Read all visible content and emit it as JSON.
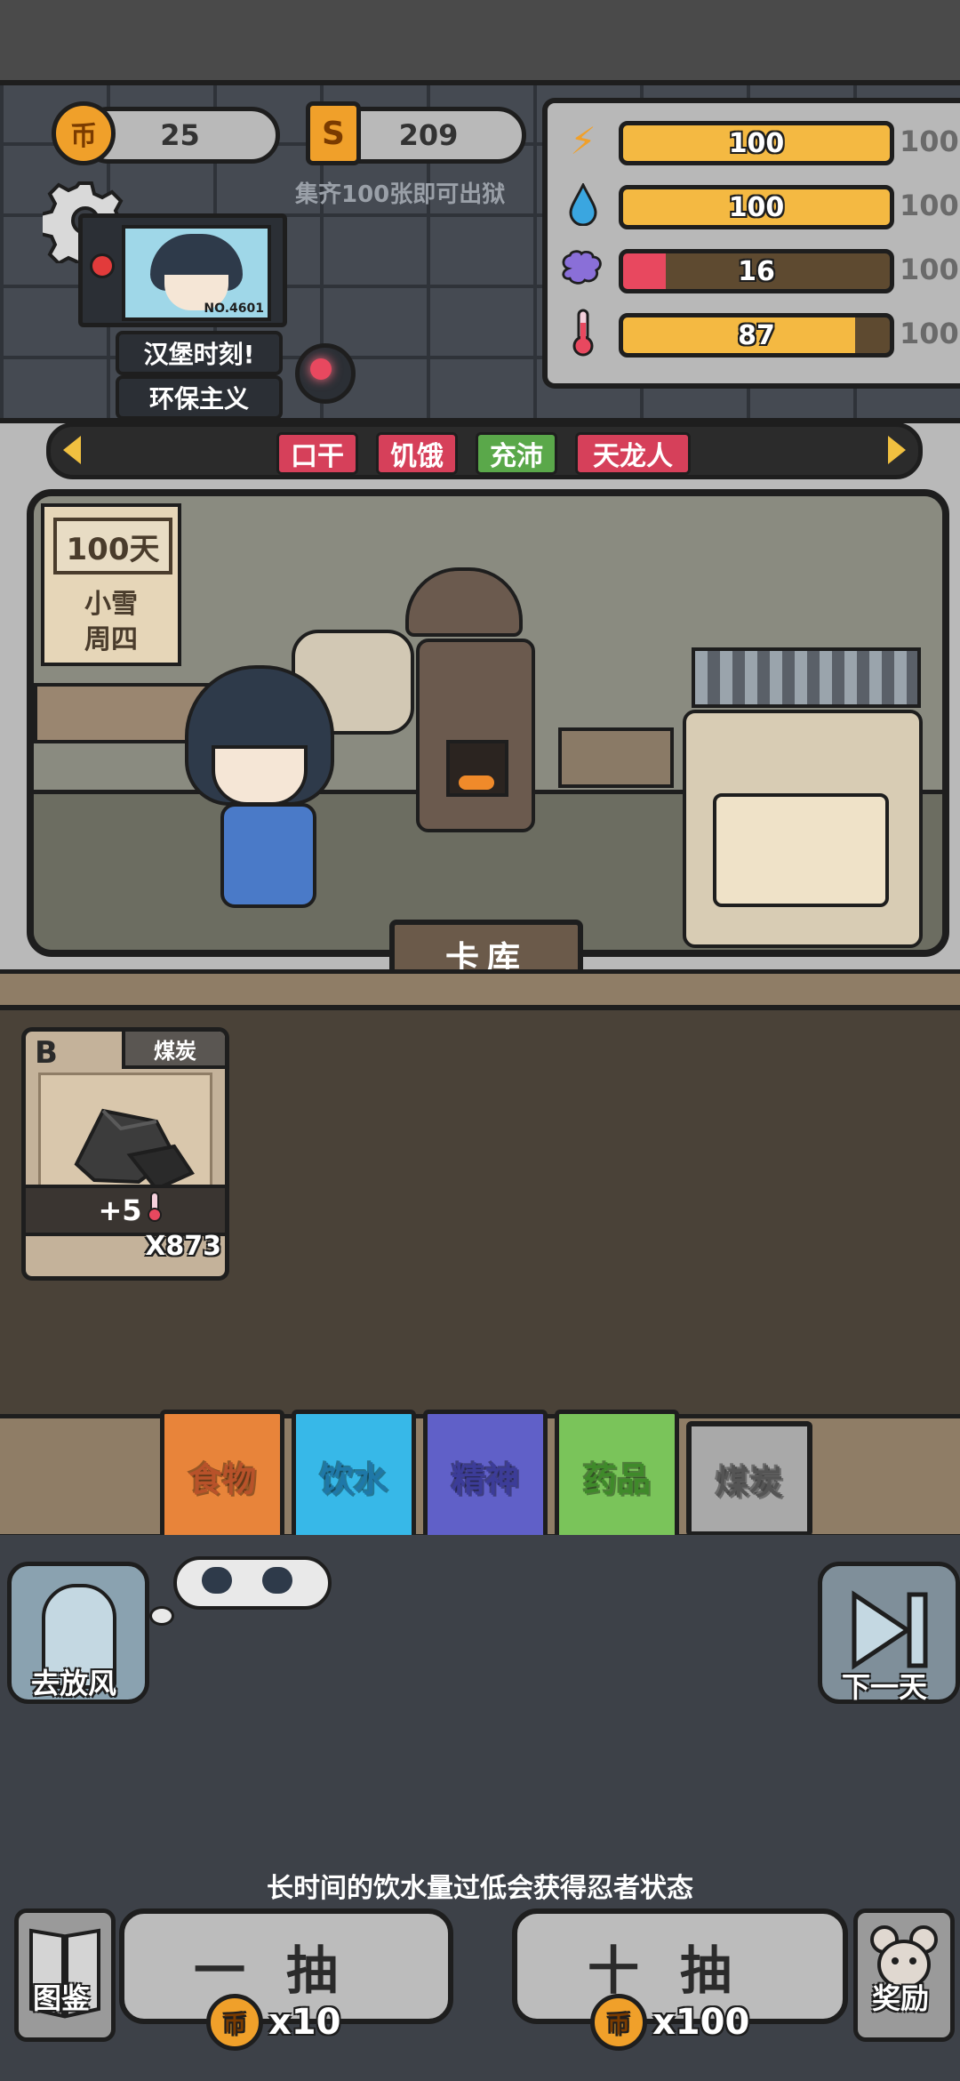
{
  "currency": {
    "coin_icon": "币",
    "coins": "25",
    "ticket_icon": "S",
    "tickets": "209",
    "hint": "集齐100张即可出狱"
  },
  "stats": [
    {
      "name": "energy",
      "icon": "lightning-icon",
      "value": "100",
      "max": "100",
      "fraction": 1.0,
      "color": "#f4b942"
    },
    {
      "name": "water",
      "icon": "water-drop-icon",
      "value": "100",
      "max": "100",
      "fraction": 1.0,
      "color": "#f4b942"
    },
    {
      "name": "mind",
      "icon": "brain-icon",
      "value": "16",
      "max": "100",
      "fraction": 0.16,
      "color": "#e8485f"
    },
    {
      "name": "warmth",
      "icon": "thermometer-icon",
      "value": "87",
      "max": "100",
      "fraction": 0.87,
      "color": "#f4b942"
    }
  ],
  "monitor": {
    "id": "NO.4601"
  },
  "tags": {
    "first": "汉堡时刻!",
    "second": "环保主义"
  },
  "status_chips": [
    {
      "label": "口干",
      "color": "#d6405a"
    },
    {
      "label": "饥饿",
      "color": "#d6405a"
    },
    {
      "label": "充沛",
      "color": "#5aa84a"
    },
    {
      "label": "天龙人",
      "color": "#d6405a"
    }
  ],
  "calendar": {
    "days": "100天",
    "weather": "小雪",
    "weekday": "周四"
  },
  "vault_label": "卡库",
  "cards": [
    {
      "grade": "B",
      "name": "煤炭",
      "effect": "+5",
      "count": "X873"
    }
  ],
  "categories": [
    {
      "label": "食物",
      "bg": "#e8843a",
      "fg": "#b8522a"
    },
    {
      "label": "饮水",
      "bg": "#37b8e8",
      "fg": "#1f78a8"
    },
    {
      "label": "精神",
      "bg": "#6060c8",
      "fg": "#3c3c98"
    },
    {
      "label": "药品",
      "bg": "#7ac45a",
      "fg": "#3f8a2a"
    },
    {
      "label": "煤炭",
      "bg": "#a9a9a9",
      "fg": "#555555"
    }
  ],
  "buttons": {
    "go_out": "去放风",
    "next_day": "下一天",
    "gallery": "图鉴",
    "reward": "奖励",
    "draw_one": "一抽",
    "draw_one_cost": "x10",
    "draw_ten": "十抽",
    "draw_ten_cost": "x100"
  },
  "tip": "长时间的饮水量过低会获得忍者状态"
}
